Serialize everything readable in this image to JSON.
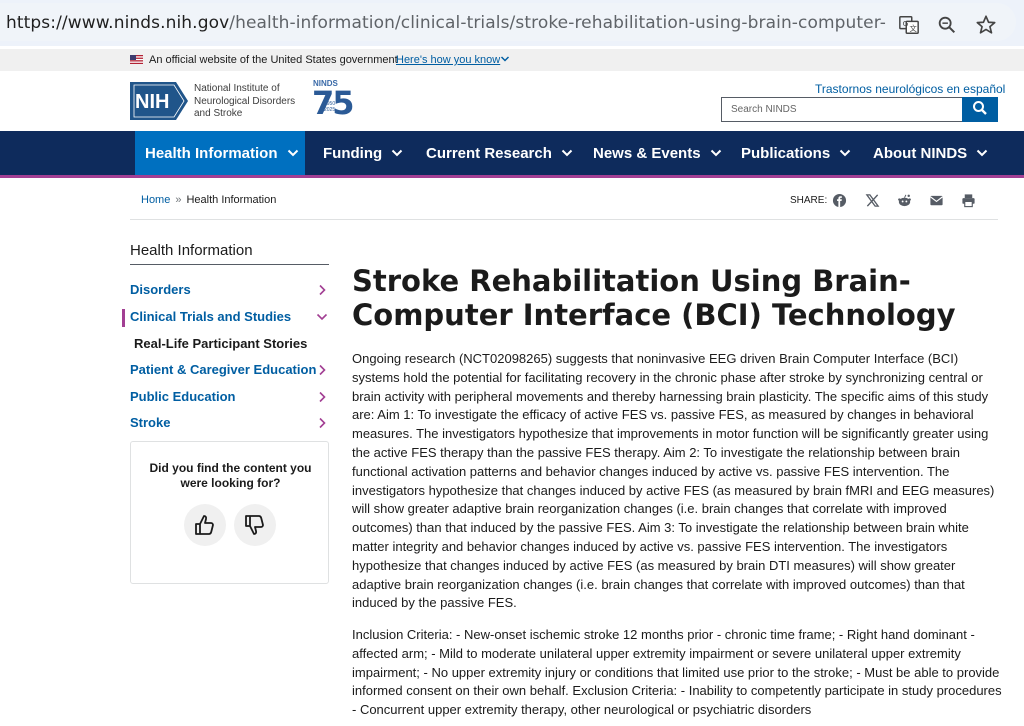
{
  "browser": {
    "url_host": "https://www.ninds.nih.gov",
    "url_path": "/health-information/clinical-trials/stroke-rehabilitation-using-brain-computer-interface-bci-te..."
  },
  "gov_banner": {
    "text": "An official website of the United States government",
    "link": "Here's how you know"
  },
  "header": {
    "logo_abbrev": "NIH",
    "logo_name_lines": [
      "National Institute of",
      "Neurological Disorders",
      "and Stroke"
    ],
    "badge_top": "NINDS",
    "badge_number": "75",
    "badge_years": [
      "1950",
      "2025"
    ],
    "spanish_link": "Trastornos neurológicos en español",
    "search_placeholder": "Search NINDS"
  },
  "nav": {
    "items": [
      "Health Information",
      "Funding",
      "Current Research",
      "News & Events",
      "Publications",
      "About NINDS"
    ]
  },
  "breadcrumb": {
    "home": "Home",
    "separator": "»",
    "current": "Health Information"
  },
  "share": {
    "label": "SHARE:",
    "icons": [
      "facebook-icon",
      "x-icon",
      "reddit-icon",
      "email-icon",
      "print-icon"
    ]
  },
  "sidebar": {
    "title": "Health Information",
    "items": [
      {
        "label": "Disorders"
      },
      {
        "label": "Clinical Trials and Studies"
      },
      {
        "label": "Real-Life Participant Stories"
      },
      {
        "label": "Patient & Caregiver Education"
      },
      {
        "label": "Public Education"
      },
      {
        "label": "Stroke"
      }
    ],
    "feedback_question": "Did you find the content you were looking for?"
  },
  "main": {
    "title": "Stroke Rehabilitation Using Brain-Computer Interface (BCI) Technology",
    "paragraph1": "Ongoing research (NCT02098265) suggests that noninvasive EEG driven Brain Computer Interface (BCI) systems hold the potential for facilitating recovery in the chronic phase after stroke by synchronizing central or brain activity with peripheral movements and thereby harnessing brain plasticity. The specific aims of this study are: Aim 1: To investigate the efficacy of active FES vs. passive FES, as measured by changes in behavioral measures. The investigators hypothesize that improvements in motor function will be significantly greater using the active FES therapy than the passive FES therapy. Aim 2: To investigate the relationship between brain functional activation patterns and behavior changes induced by active vs. passive FES intervention. The investigators hypothesize that changes induced by active FES (as measured by brain fMRI and EEG measures) will show greater adaptive brain reorganization changes (i.e. brain changes that correlate with improved outcomes) than that induced by the passive FES. Aim 3: To investigate the relationship between brain white matter integrity and behavior changes induced by active vs. passive FES intervention. The investigators hypothesize that changes induced by active FES (as measured by brain DTI measures) will show greater adaptive brain reorganization changes (i.e. brain changes that correlate with improved outcomes) than that induced by the passive FES.",
    "paragraph2": "Inclusion Criteria: - New-onset ischemic stroke 12 months prior - chronic time frame; - Right hand dominant - affected arm; - Mild to moderate unilateral upper extremity impairment or severe unilateral upper extremity impairment; - No upper extremity injury or conditions that limited use prior to the stroke; - Must be able to provide informed consent on their own behalf. Exclusion Criteria: - Inability to competently participate in study procedures - Concurrent upper extremity therapy, other neurological or psychiatric disorders"
  },
  "colors": {
    "nav_bg": "#0e2b5c",
    "nav_active": "#0070c0",
    "accent": "#a23f93",
    "link": "#005ea2"
  }
}
